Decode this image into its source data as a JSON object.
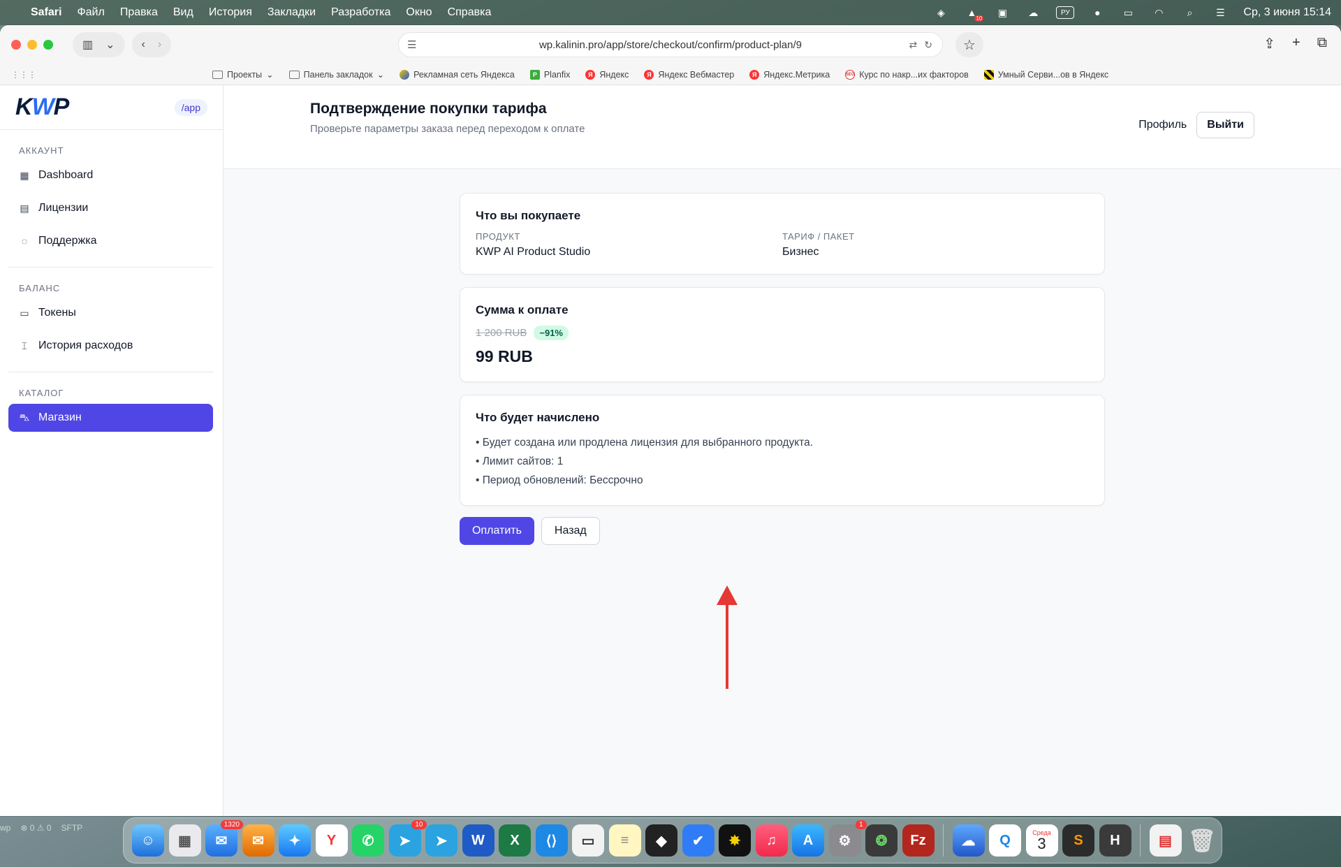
{
  "menubar": {
    "app_name": "Safari",
    "items": [
      "Файл",
      "Правка",
      "Вид",
      "История",
      "Закладки",
      "Разработка",
      "Окно",
      "Справка"
    ],
    "lang": "РУ",
    "badge": "10",
    "clock": "Ср, 3 июня  15:14"
  },
  "browser": {
    "url": "wp.kalinin.pro/app/store/checkout/confirm/product-plan/9",
    "bookmarks": [
      {
        "label": "Проекты",
        "icon": "folder-icon",
        "dropdown": true
      },
      {
        "label": "Панель закладок",
        "icon": "folder-icon",
        "dropdown": true
      },
      {
        "label": "Рекламная сеть Яндекса",
        "icon": "yandex-ads-icon"
      },
      {
        "label": "Planfix",
        "icon": "planfix-icon"
      },
      {
        "label": "Яндекс",
        "icon": "yandex-icon"
      },
      {
        "label": "Яндекс Вебмастер",
        "icon": "yandex-icon"
      },
      {
        "label": "Яндекс.Метрика",
        "icon": "yandex-icon"
      },
      {
        "label": "Курс по накр...их факторов",
        "icon": "seo-icon"
      },
      {
        "label": "Умный Серви...ов в Яндекс",
        "icon": "striped-icon"
      }
    ]
  },
  "sidebar": {
    "logo": "KWP",
    "badge": "/app",
    "sections": [
      {
        "title": "АККАУНТ",
        "items": [
          {
            "label": "Dashboard",
            "icon": "grid-icon"
          },
          {
            "label": "Лицензии",
            "icon": "document-icon"
          },
          {
            "label": "Поддержка",
            "icon": "chat-icon"
          }
        ]
      },
      {
        "title": "БАЛАНС",
        "items": [
          {
            "label": "Токены",
            "icon": "card-icon"
          },
          {
            "label": "История расходов",
            "icon": "history-icon"
          }
        ]
      },
      {
        "title": "КАТАЛОГ",
        "items": [
          {
            "label": "Магазин",
            "icon": "cart-icon",
            "active": true
          }
        ]
      }
    ]
  },
  "header": {
    "title": "Подтверждение покупки тарифа",
    "subtitle": "Проверьте параметры заказа перед переходом к оплате",
    "profile": "Профиль",
    "logout": "Выйти"
  },
  "purchase": {
    "title": "Что вы покупаете",
    "product_label": "ПРОДУКТ",
    "product_value": "KWP AI Product Studio",
    "plan_label": "ТАРИФ / ПАКЕТ",
    "plan_value": "Бизнес"
  },
  "payment": {
    "title": "Сумма к оплате",
    "old_price": "1 200 RUB",
    "discount": "−91%",
    "new_price": "99 RUB"
  },
  "accrual": {
    "title": "Что будет начислено",
    "items": [
      "• Будет создана или продлена лицензия для выбранного продукта.",
      "• Лимит сайтов: 1",
      "• Период обновлений: Бессрочно"
    ]
  },
  "actions": {
    "pay": "Оплатить",
    "back": "Назад"
  },
  "colors": {
    "accent": "#4f46e5",
    "arrow": "#e53935"
  },
  "statusbar": {
    "left": "wp",
    "counts": "⊗ 0 ⚠ 0",
    "sftp": "SFTP"
  },
  "dock": {
    "mail_badge": "1320",
    "telegram_badge": "10",
    "settings_badge": "1",
    "calendar_day": "Среда",
    "calendar_date": "3"
  }
}
